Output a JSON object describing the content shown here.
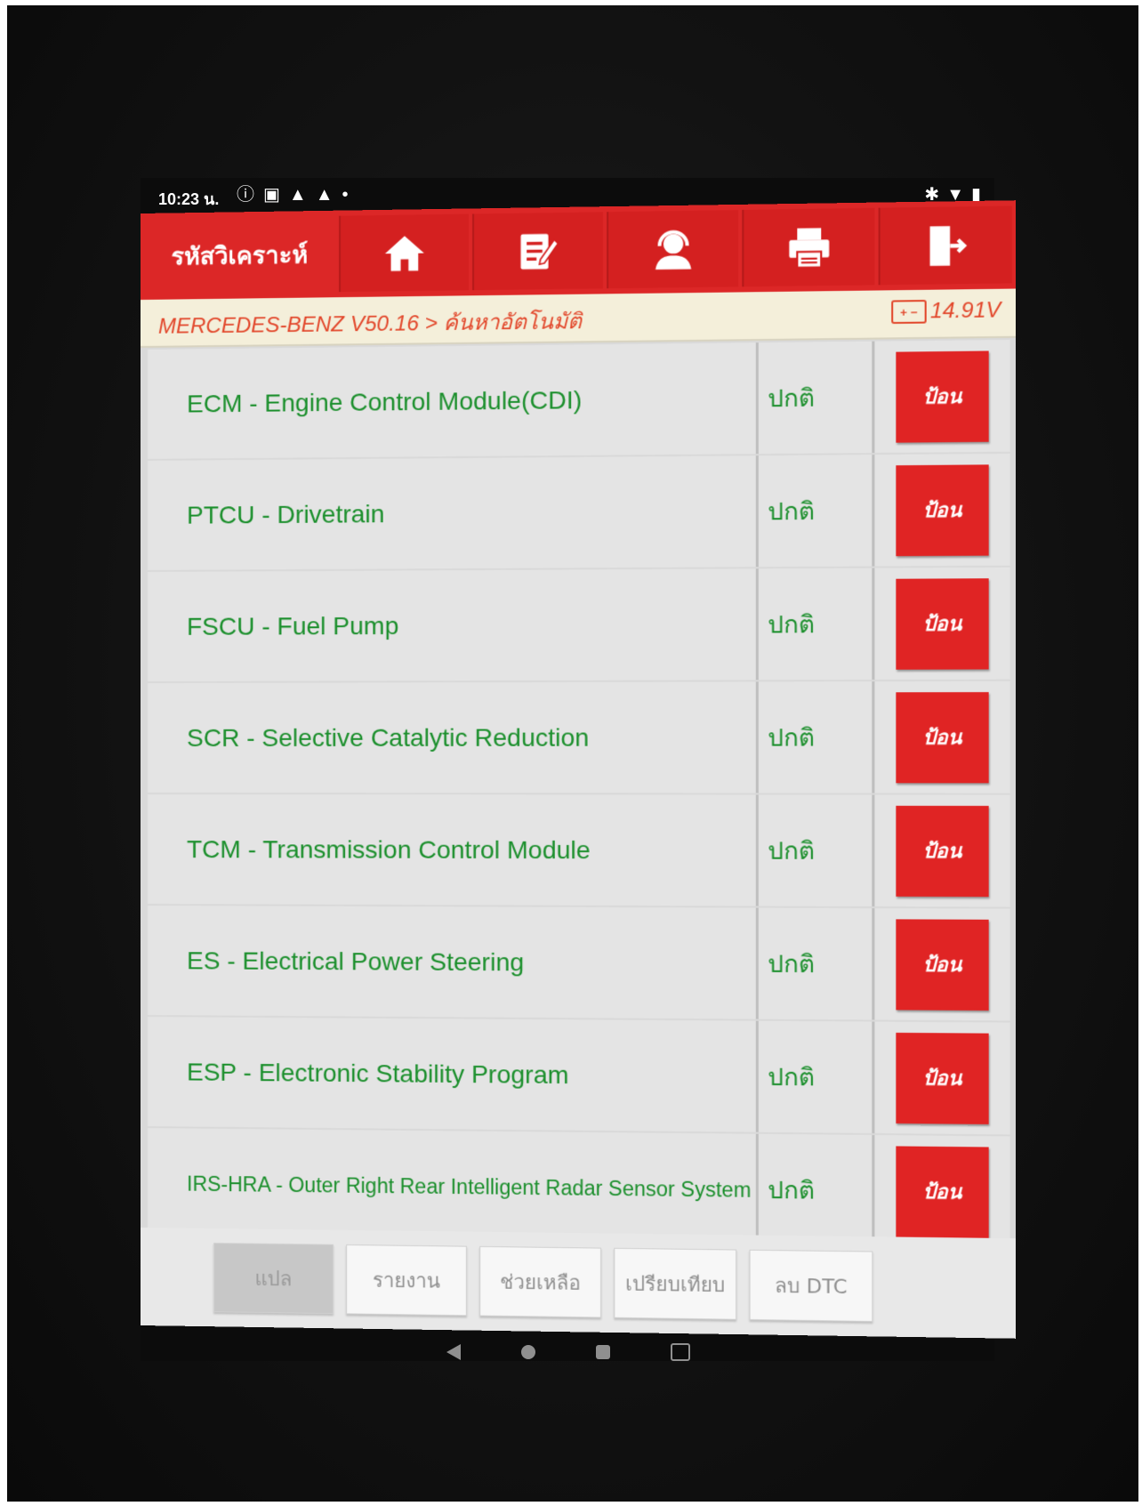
{
  "status_bar": {
    "time": "10:23 น.",
    "left_icons": [
      "alert-circle-icon",
      "calendar-icon",
      "warning-icon",
      "warning-icon",
      "dot-icon"
    ],
    "right_icons": [
      "bluetooth-icon",
      "wifi-icon",
      "battery-icon"
    ]
  },
  "toolbar": {
    "title": "รหัสวิเคราะห์",
    "buttons": [
      "home-icon",
      "edit-icon",
      "support-agent-icon",
      "print-icon",
      "exit-icon"
    ]
  },
  "breadcrumb": {
    "path": "MERCEDES-BENZ V50.16 > ค้นหาอัตโนมัติ",
    "voltage": "14.91V",
    "battery_symbol": "+ −"
  },
  "systems": [
    {
      "name": "ECM - Engine Control Module(CDI)",
      "status": "ปกติ",
      "action": "ป้อน"
    },
    {
      "name": "PTCU - Drivetrain",
      "status": "ปกติ",
      "action": "ป้อน"
    },
    {
      "name": "FSCU - Fuel Pump",
      "status": "ปกติ",
      "action": "ป้อน"
    },
    {
      "name": "SCR - Selective Catalytic Reduction",
      "status": "ปกติ",
      "action": "ป้อน"
    },
    {
      "name": "TCM - Transmission Control Module",
      "status": "ปกติ",
      "action": "ป้อน"
    },
    {
      "name": "ES - Electrical Power Steering",
      "status": "ปกติ",
      "action": "ป้อน"
    },
    {
      "name": "ESP - Electronic Stability Program",
      "status": "ปกติ",
      "action": "ป้อน"
    },
    {
      "name": "IRS-HRA - Outer Right Rear Intelligent Radar Sensor System",
      "status": "ปกติ",
      "action": "ป้อน"
    }
  ],
  "bottom_tabs": [
    "แปล",
    "รายงาน",
    "ช่วยเหลือ",
    "เปรียบเทียบ",
    "ลบ DTC"
  ],
  "colors": {
    "toolbar_red": "#dc2727",
    "system_text_green": "#1b8f2c",
    "breadcrumb_orange": "#e2472b",
    "enter_button_red": "#e02424"
  }
}
